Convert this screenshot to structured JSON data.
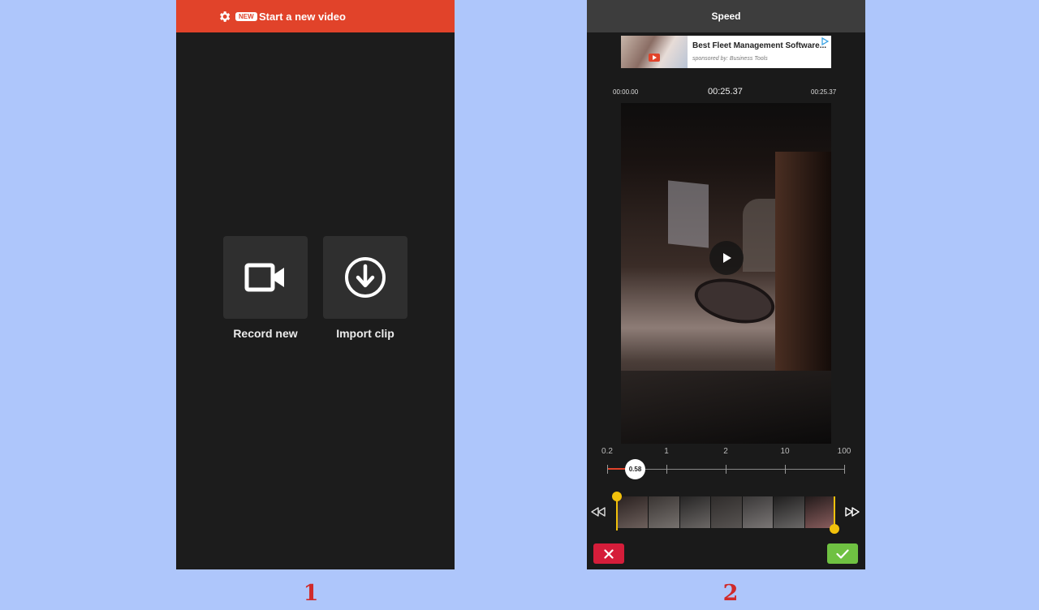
{
  "screen1": {
    "header": {
      "badge": "NEW",
      "title": "Start a new video"
    },
    "actions": [
      {
        "label": "Record new",
        "icon": "video-camera-icon"
      },
      {
        "label": "Import clip",
        "icon": "download-circle-icon"
      }
    ]
  },
  "screen2": {
    "header": {
      "title": "Speed"
    },
    "ad": {
      "title": "Best Fleet Management Software...",
      "sponsor": "sponsored by: Business Tools"
    },
    "times": {
      "start": "00:00.00",
      "current": "00:25.37",
      "end": "00:25.37"
    },
    "speed_scale": [
      "0.2",
      "1",
      "2",
      "10",
      "100"
    ],
    "speed_value": "0.58"
  },
  "labels": {
    "step1": "1",
    "step2": "2"
  },
  "colors": {
    "accent": "#e1432a",
    "handle": "#f2c10b",
    "cancel": "#d51d3a",
    "confirm": "#6fc142"
  }
}
